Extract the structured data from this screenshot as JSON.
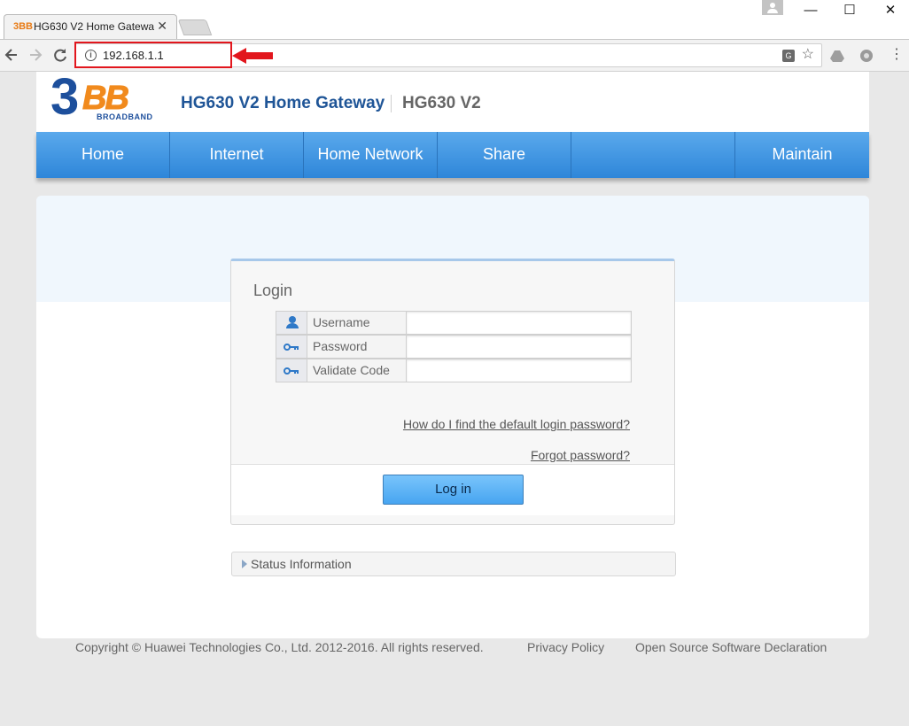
{
  "browser": {
    "tab_title": "HG630 V2 Home Gatewa",
    "tab_favicon": "3BB",
    "tab_close": "✕",
    "url": "192.168.1.1",
    "window_controls": {
      "minimize": "—",
      "maximize": "☐",
      "close": "✕"
    }
  },
  "icons": {
    "back": "back-arrow-icon",
    "forward": "forward-arrow-icon",
    "reload": "reload-icon",
    "info": "info-icon",
    "translate": "translate-icon",
    "star": "star-icon",
    "drive": "drive-icon",
    "extension": "extension-icon",
    "menu": "menu-icon",
    "annotation": "red-arrow-icon",
    "user": "user-icon",
    "key": "key-icon"
  },
  "header": {
    "logo_main": "3",
    "logo_bb": "BB",
    "logo_sub": "BROADBAND",
    "title": "HG630 V2 Home Gateway",
    "model": "HG630 V2"
  },
  "menu": {
    "items": [
      "Home",
      "Internet",
      "Home Network",
      "Share",
      "",
      "Maintain"
    ]
  },
  "login": {
    "heading": "Login",
    "fields": [
      {
        "label": "Username",
        "icon": "user-icon",
        "value": ""
      },
      {
        "label": "Password",
        "icon": "key-icon",
        "value": ""
      },
      {
        "label": "Validate Code",
        "icon": "key-icon",
        "value": ""
      }
    ],
    "help_link": "How do I find the default login password?",
    "forgot_link": "Forgot password?",
    "button": "Log in"
  },
  "status": {
    "label": "Status Information"
  },
  "footer": {
    "copyright": "Copyright © Huawei Technologies Co., Ltd. 2012-2016. All rights reserved.",
    "privacy": "Privacy Policy",
    "opensource": "Open Source Software Declaration"
  },
  "colors": {
    "accent": "#3a92e0",
    "annotation": "#e2161d",
    "brand_blue": "#1d4f9c",
    "brand_orange": "#f18a1d"
  }
}
